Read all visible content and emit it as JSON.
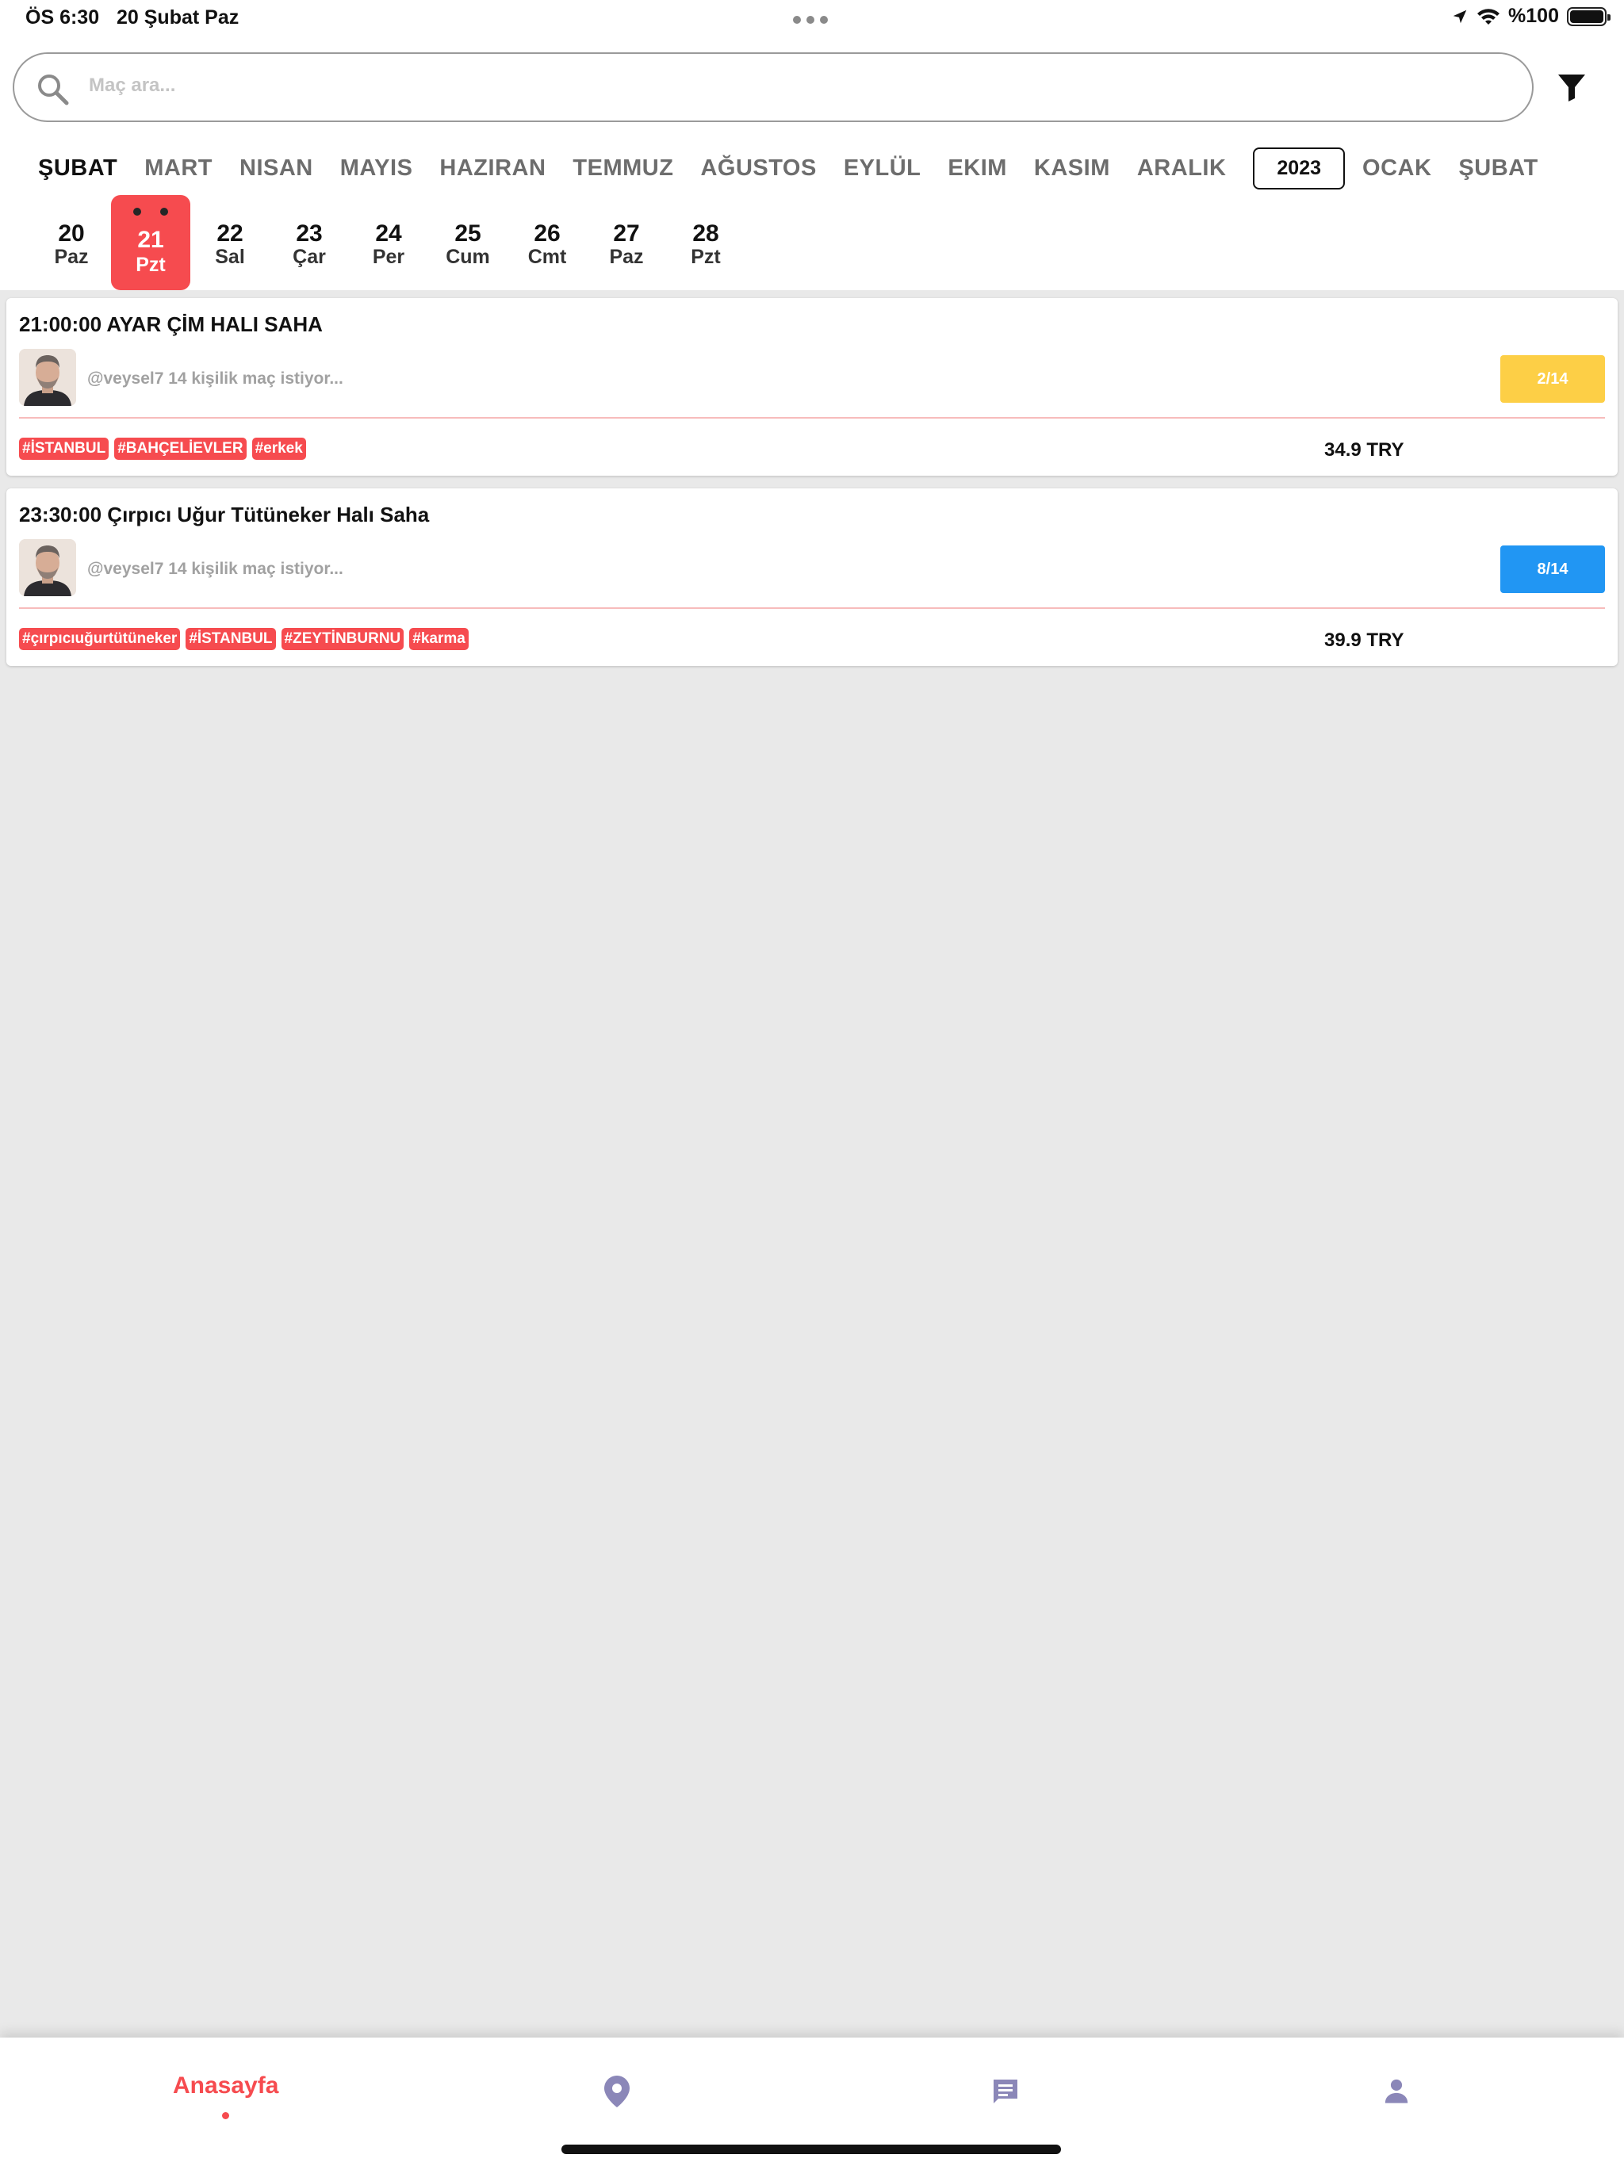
{
  "status_bar": {
    "time": "ÖS 6:30",
    "date": "20 Şubat Paz",
    "battery": "%100"
  },
  "search": {
    "placeholder": "Maç ara..."
  },
  "months": [
    {
      "label": "ŞUBAT",
      "active": true
    },
    {
      "label": "MART"
    },
    {
      "label": "NISAN"
    },
    {
      "label": "MAYIS"
    },
    {
      "label": "HAZIRAN"
    },
    {
      "label": "TEMMUZ"
    },
    {
      "label": "AĞUSTOS"
    },
    {
      "label": "EYLÜL"
    },
    {
      "label": "EKIM"
    },
    {
      "label": "KASIM"
    },
    {
      "label": "ARALIK"
    }
  ],
  "year": "2023",
  "months_next": [
    {
      "label": "OCAK"
    },
    {
      "label": "ŞUBAT"
    }
  ],
  "days": [
    {
      "num": "20",
      "wd": "Paz"
    },
    {
      "num": "21",
      "wd": "Pzt",
      "selected": true
    },
    {
      "num": "22",
      "wd": "Sal"
    },
    {
      "num": "23",
      "wd": "Çar"
    },
    {
      "num": "24",
      "wd": "Per"
    },
    {
      "num": "25",
      "wd": "Cum"
    },
    {
      "num": "26",
      "wd": "Cmt"
    },
    {
      "num": "27",
      "wd": "Paz"
    },
    {
      "num": "28",
      "wd": "Pzt"
    }
  ],
  "matches": [
    {
      "title": "21:00:00 AYAR ÇİM HALI SAHA",
      "user": "@veysel7 14 kişilik maç istiyor...",
      "count": "2/14",
      "count_color": "#fdcf46",
      "tags": [
        "#İSTANBUL",
        "#BAHÇELİEVLER",
        "#erkek"
      ],
      "price": "34.9 TRY"
    },
    {
      "title": "23:30:00 Çırpıcı Uğur Tütüneker Halı Saha",
      "user": "@veysel7 14 kişilik maç istiyor...",
      "count": "8/14",
      "count_color": "#2196f3",
      "tags": [
        "#çırpıcıuğurtütüneker",
        "#İSTANBUL",
        "#ZEYTİNBURNU",
        "#karma"
      ],
      "price": "39.9 TRY"
    }
  ],
  "nav": {
    "home_label": "Anasayfa",
    "accent": "#f64b4f",
    "icon_color": "#8b87b8",
    "icons": [
      "map-pin-icon",
      "chat-icon",
      "person-icon"
    ]
  }
}
